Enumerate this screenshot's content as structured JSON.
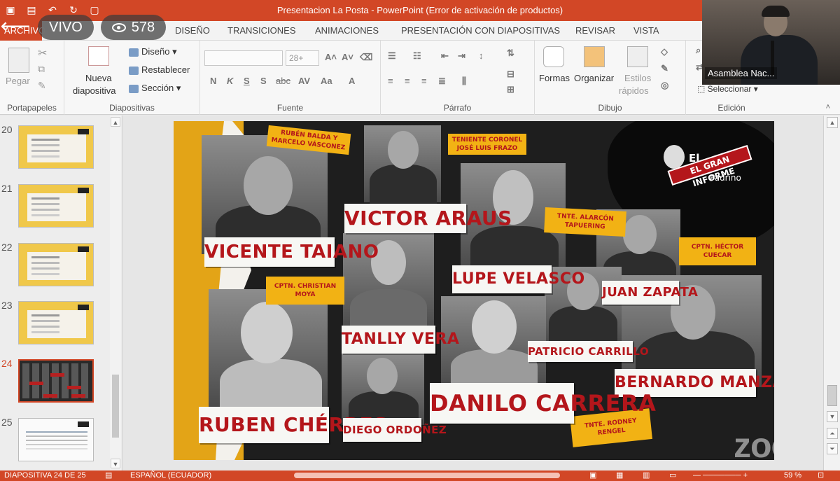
{
  "window": {
    "title": "Presentacion La Posta -  PowerPoint (Error de activación de productos)"
  },
  "live": {
    "status_label": "VIVO",
    "viewer_count": "578"
  },
  "ribbon_tabs": {
    "archivo": "ARCHIVO",
    "diseno_partial": "DISEÑO",
    "transiciones": "TRANSICIONES",
    "animaciones": "ANIMACIONES",
    "presentacion": "PRESENTACIÓN CON DIAPOSITIVAS",
    "revisar": "REVISAR",
    "vista": "VISTA"
  },
  "ribbon": {
    "portapapeles": {
      "paste": "Pegar",
      "label": "Portapapeles"
    },
    "diapositivas": {
      "new_slide_line1": "Nueva",
      "new_slide_line2": "diapositiva",
      "layout": "Diseño",
      "reset": "Restablecer",
      "section": "Sección",
      "label": "Diapositivas"
    },
    "fuente": {
      "size": "28+",
      "label": "Fuente",
      "letters": [
        "N",
        "K",
        "S",
        "S",
        "abc"
      ]
    },
    "parrafo": {
      "label": "Párrafo"
    },
    "dibujo": {
      "formas": "Formas",
      "organizar": "Organizar",
      "estilos_1": "Estilos",
      "estilos_2": "rápidos",
      "label": "Dibujo"
    },
    "edicion": {
      "seleccionar": "Seleccionar",
      "label": "Edición"
    }
  },
  "video": {
    "participant_name": "Asamblea Nac..."
  },
  "thumbnails": [
    {
      "number": "20"
    },
    {
      "number": "21"
    },
    {
      "number": "22"
    },
    {
      "number": "23"
    },
    {
      "number": "24",
      "active": true
    },
    {
      "number": "25"
    }
  ],
  "slide": {
    "brand_title": "El",
    "brand_stamp": "EL GRAN INFORME",
    "brand_sub": "Padrino",
    "names": {
      "vicente": "VICENTE TAIANO",
      "victor": "VICTOR ARAUS",
      "lupe": "LUPE VELASCO",
      "juan": "JUAN ZAPATA",
      "tanlly": "TANLLY VERA",
      "patricio": "PATRICIO CARRILLO",
      "bernardo": "BERNARDO MANZANO",
      "ruben": "RUBEN CHÉRRES",
      "diego": "DIEGO ORDOÑEZ",
      "danilo": "DANILO CARRERA"
    },
    "tags": {
      "ruben_balda": "RUBÉN BALDA Y MARCELO VÁSCONEZ",
      "frazo": "TENIENTE CORONEL JOSÉ LUIS FRAZO",
      "tapuring": "TNTE. ALARCÓN TAPUERING",
      "cuecar": "CPTN. HÉCTOR CUECAR",
      "moya": "CPTN. CHRISTIAN MOYA",
      "rengel": "TNTE. RODNEY RENGEL"
    }
  },
  "watermark": "zoom",
  "status": {
    "slide_info": "DIAPOSITIVA 24 DE 25",
    "language": "ESPAÑOL (ECUADOR)",
    "zoom": "59 %"
  }
}
